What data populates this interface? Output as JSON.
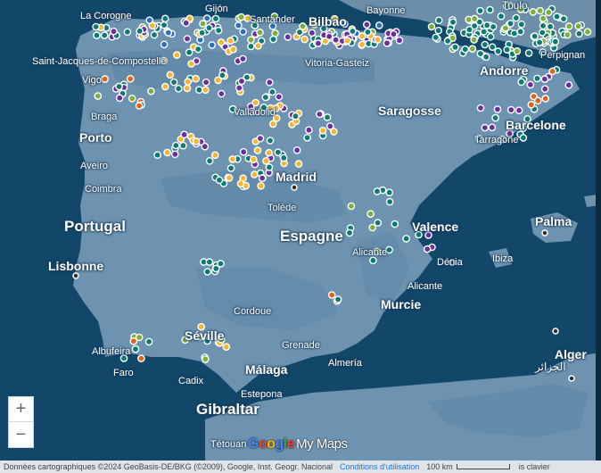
{
  "map": {
    "labels": {
      "la_corogne": "La Corogne",
      "gijon": "Gijón",
      "santander": "Santander",
      "bilbao": "Bilbao",
      "bayonne": "Bayonne",
      "toulouse": "Toulo",
      "saint_jacques": "Saint-Jacques-de-Compostelle",
      "vitoria": "Vitoria-Gasteiz",
      "perpignan": "Perpignan",
      "andorre": "Andorre",
      "vigo": "Vigo",
      "braga": "Braga",
      "valladolid": "Valladolid",
      "saragosse": "Saragosse",
      "porto": "Porto",
      "barcelone": "Barcelone",
      "tarragone": "Tarragone",
      "aveiro": "Aveiro",
      "madrid": "Madrid",
      "coimbra": "Coimbra",
      "portugal": "Portugal",
      "tolede": "Tolède",
      "valence": "Valence",
      "palma": "Palma",
      "espagne": "Espagne",
      "lisbonne": "Lisbonne",
      "alicante_coast": "Alicante",
      "denia": "Dénia",
      "ibiza": "Ibiza",
      "alicante": "Alicante",
      "cordoue": "Cordoue",
      "murcie": "Murcie",
      "seville": "Séville",
      "albufeira": "Albufeira",
      "grenade": "Grenade",
      "malaga": "Málaga",
      "almeria": "Almería",
      "alger": "Alger",
      "alger_ar": "الجزائر",
      "faro": "Faro",
      "cadix": "Cadix",
      "estepona": "Estepona",
      "gibraltar": "Gibraltar",
      "tetouan": "Tétouan"
    },
    "marker_colors": {
      "teal": "#0a7a72",
      "yellow": "#f3b632",
      "purple": "#6a2e9e",
      "green": "#7bb03a",
      "orange": "#e0621b",
      "blue": "#2b6fc0",
      "dark": "#1d3b30"
    },
    "colors": {
      "sea": "#12476a",
      "land": "#6e93b0",
      "land_dark": "#557d9c",
      "france": "#6d8ea9"
    }
  },
  "controls": {
    "zoom_in": "+",
    "zoom_out": "−"
  },
  "logo": {
    "g": "G",
    "o1": "o",
    "o2": "o",
    "g2": "g",
    "l": "l",
    "e": "e",
    "mymaps": "My Maps"
  },
  "attribution": {
    "data": "Données cartographiques ©2024 GeoBasis-DE/BKG (©2009), Google, Inst. Geogr. Nacional",
    "terms": "Conditions d'utilisation",
    "scale": "100 km",
    "shortcuts": "is clavier"
  }
}
